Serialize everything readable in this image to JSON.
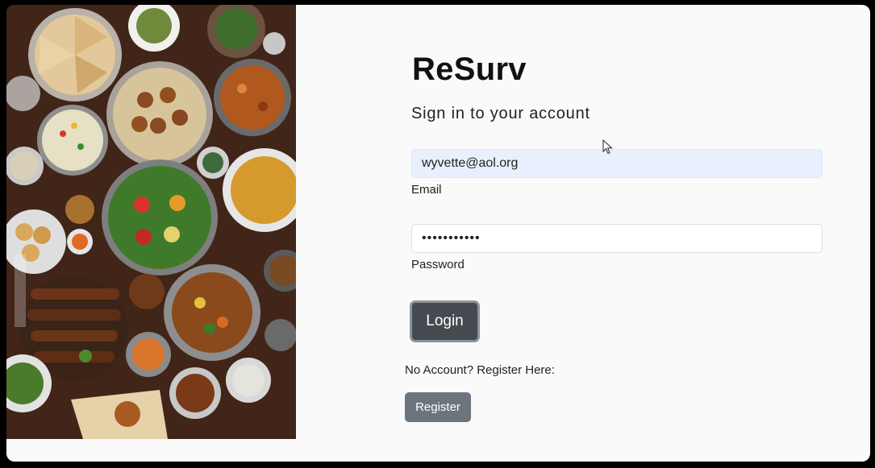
{
  "image": {
    "alt_icon": "food-photo"
  },
  "app": {
    "brand": "ReSurv",
    "subtitle": "Sign in to your account"
  },
  "form": {
    "email": {
      "value": "wyvette@aol.org",
      "label": "Email"
    },
    "password": {
      "value": "•••••••••••",
      "label": "Password"
    },
    "login_label": "Login",
    "no_account_text": "No Account? Register Here:",
    "register_label": "Register"
  },
  "colors": {
    "background": "#fafafa",
    "autofill": "#e8f0fe",
    "login_button": "#444a4f",
    "register_button": "#6c757d"
  }
}
